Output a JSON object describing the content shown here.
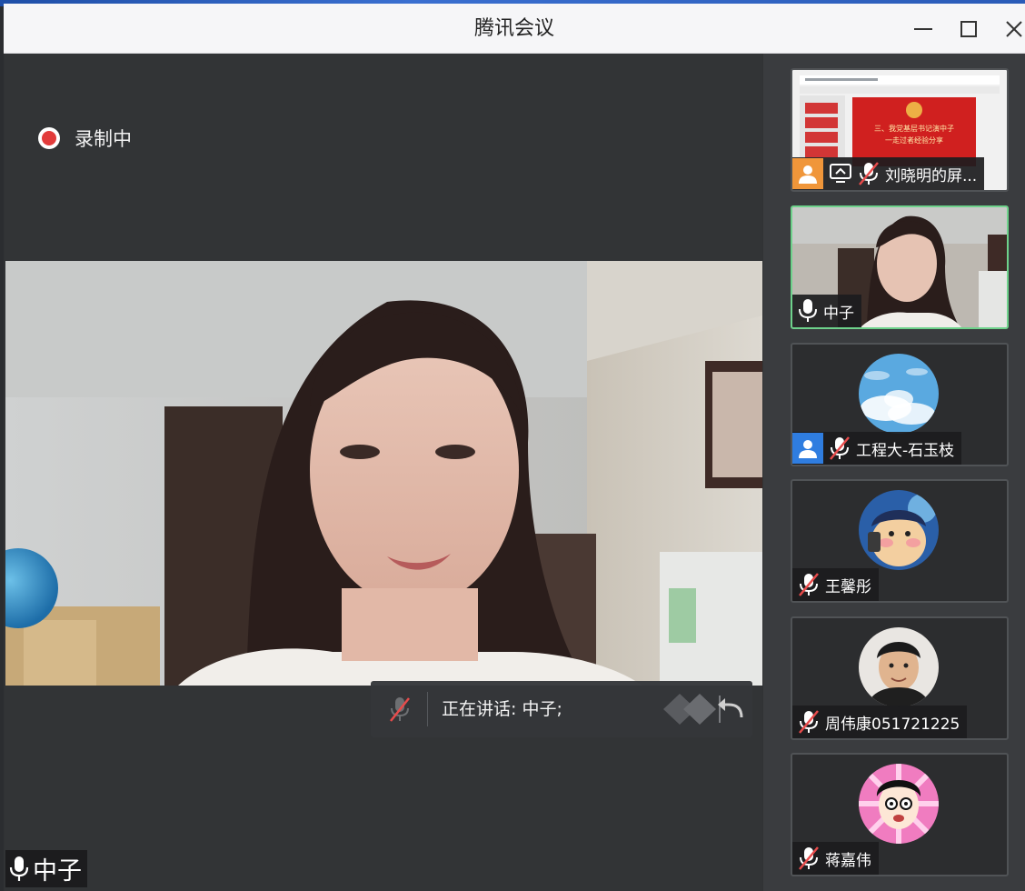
{
  "window": {
    "title": "腾讯会议"
  },
  "recording": {
    "label": "录制中"
  },
  "speaker_bar": {
    "text": "正在讲话: 中子;"
  },
  "main_video": {
    "name": "中子"
  },
  "participants": [
    {
      "name": "刘晓明的屏...",
      "mic": "muted",
      "role": "host",
      "sharing": true,
      "share_preview": {
        "line1": "三、我党基层书记演中子",
        "line2": "一走过者经验分享"
      }
    },
    {
      "name": "中子",
      "mic": "on",
      "active": true
    },
    {
      "name": "工程大-石玉枝",
      "mic": "muted",
      "role": "user"
    },
    {
      "name": "王馨彤",
      "mic": "muted"
    },
    {
      "name": "周伟康051721225",
      "mic": "muted"
    },
    {
      "name": "蒋嘉伟",
      "mic": "muted"
    }
  ],
  "colors": {
    "recording_red": "#e23b3b",
    "active_border": "#6ed28b",
    "host_badge": "#f0963a",
    "user_badge": "#2f7de0",
    "mute_red": "#e84b4b"
  },
  "icons": [
    "minimize-icon",
    "maximize-icon",
    "close-icon",
    "record-dot-icon",
    "mic-muted-icon",
    "mic-icon",
    "screen-share-icon",
    "user-icon",
    "collapse-icon"
  ]
}
